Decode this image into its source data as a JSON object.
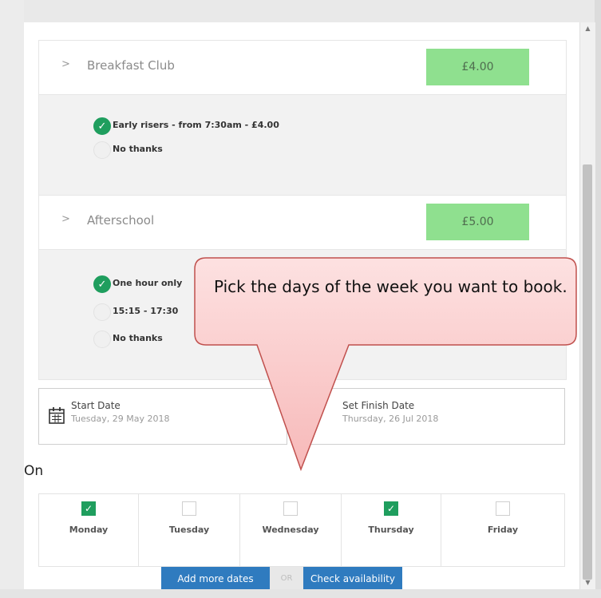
{
  "groups": [
    {
      "title": "Breakfast Club",
      "price": "£4.00",
      "options": [
        {
          "label": "Early risers - from 7:30am - £4.00",
          "checked": true
        },
        {
          "label": "No thanks",
          "checked": false
        }
      ]
    },
    {
      "title": "Afterschool",
      "price": "£5.00",
      "options": [
        {
          "label": "One hour only",
          "checked": true
        },
        {
          "label": "15:15 - 17:30",
          "checked": false
        },
        {
          "label": "No thanks",
          "checked": false
        }
      ]
    }
  ],
  "start_date": {
    "title": "Start Date",
    "value": "Tuesday, 29 May 2018"
  },
  "finish_date": {
    "title": "Set Finish Date",
    "value": "Thursday, 26 Jul 2018"
  },
  "on_label": "On",
  "days": [
    {
      "label": "Monday",
      "checked": true
    },
    {
      "label": "Tuesday",
      "checked": false
    },
    {
      "label": "Wednesday",
      "checked": false
    },
    {
      "label": "Thursday",
      "checked": true
    },
    {
      "label": "Friday",
      "checked": false
    }
  ],
  "buttons": {
    "add_more_dates": "Add more dates",
    "or": "OR",
    "check_availability": "Check availability"
  },
  "callout": {
    "text": "Pick the days of the week you want to book."
  },
  "colors": {
    "price_bg": "#8fe08f",
    "checked_green": "#1f9e5e",
    "button_blue": "#2f7bbf",
    "callout_fill": "#fbd3d3",
    "callout_border": "#c0504d"
  },
  "icons": [
    "chevron-right-icon",
    "check-icon",
    "calendar-icon",
    "no-end-date-icon",
    "scroll-up-icon",
    "scroll-down-icon"
  ]
}
